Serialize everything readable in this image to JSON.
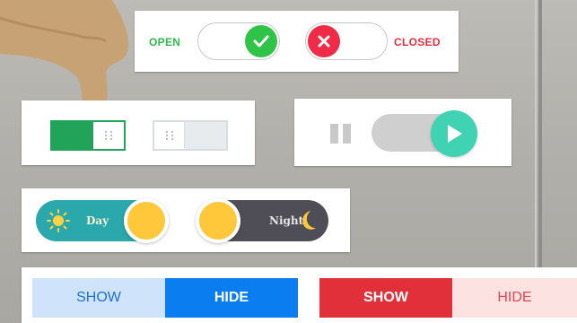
{
  "toggles": {
    "open_closed": {
      "open_label": "OPEN",
      "closed_label": "CLOSED",
      "open_icon": "check-icon",
      "closed_icon": "x-icon",
      "open_color": "#2fc447",
      "closed_color": "#ef2b47"
    },
    "square": {
      "on_color": "#21a35a",
      "off_color": "#e8ebee",
      "knob_icon": "grip-dots-icon"
    },
    "play_pause": {
      "pause_icon": "pause-icon",
      "play_icon": "play-icon",
      "accent": "#3fd3b3"
    },
    "day_night": {
      "day_label": "Day",
      "night_label": "Night",
      "day_icon": "sun-icon",
      "night_icon": "moon-icon",
      "day_color": "#2aa8ac",
      "night_color": "#4f4e56",
      "knob_color": "#ffc83a"
    },
    "show_hide_blue": {
      "show_label": "SHOW",
      "hide_label": "HIDE",
      "active": "HIDE",
      "color": "#0a7df0"
    },
    "show_hide_red": {
      "show_label": "SHOW",
      "hide_label": "HIDE",
      "active": "SHOW",
      "color": "#e2303a"
    }
  }
}
